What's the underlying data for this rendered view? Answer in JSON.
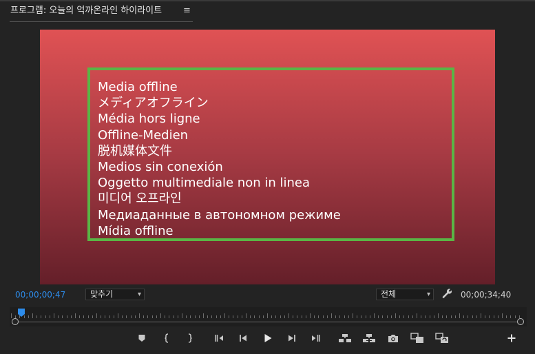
{
  "panel": {
    "title": "프로그램: 오늘의 억까온라인 하이라이트",
    "menu_icon": "≡"
  },
  "video": {
    "offline_lines": [
      "Media offline",
      "メディアオフライン",
      "Média hors ligne",
      "Offline-Medien",
      "脱机媒体文件",
      "Medios sin conexión",
      "Oggetto multimediale non in linea",
      "미디어 오프라인",
      "Медиаданные в автономном режиме",
      "Mídia offline"
    ],
    "background_top": "#e05254",
    "background_bottom": "#641f29",
    "box_border_color": "#5ab545"
  },
  "controls": {
    "current_timecode": "00;00;00;47",
    "fit_dropdown": "맞추기",
    "resolution_dropdown": "전체",
    "duration_timecode": "00;00;34;40",
    "timecode_color": "#2d8ceb"
  },
  "transport": {
    "buttons": [
      "add-marker-icon",
      "mark-in-icon",
      "mark-out-icon",
      "go-to-in-icon",
      "step-back-icon",
      "play-icon",
      "step-forward-icon",
      "go-to-out-icon",
      "lift-icon",
      "extract-icon",
      "export-frame-icon",
      "comparison-view-icon",
      "proxy-toggle-icon",
      "button-editor-icon"
    ]
  }
}
